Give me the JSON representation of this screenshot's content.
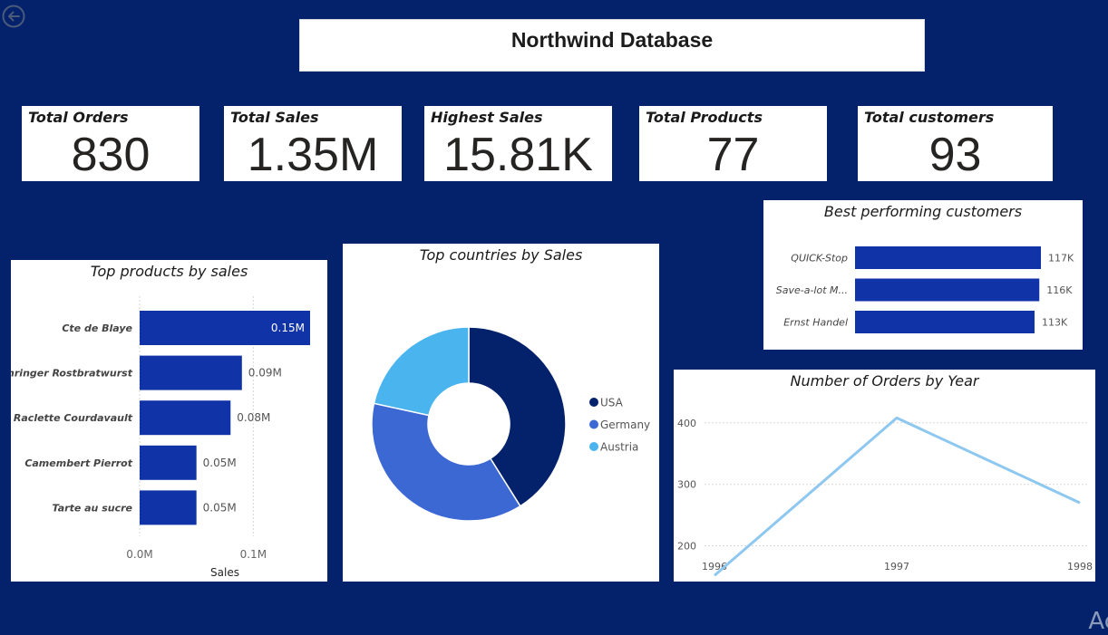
{
  "header": {
    "title": "Northwind Database"
  },
  "kpis": [
    {
      "label": "Total Orders",
      "value": "830"
    },
    {
      "label": "Total Sales",
      "value": "1.35M"
    },
    {
      "label": "Highest Sales",
      "value": "15.81K"
    },
    {
      "label": "Total Products",
      "value": "77"
    },
    {
      "label": "Total customers",
      "value": "93"
    }
  ],
  "colors": {
    "background": "#03226b",
    "bar": "#1033a7",
    "usa": "#03226b",
    "germany": "#3c68d3",
    "austria": "#4ab4ef",
    "line": "#8ec8f0"
  },
  "corner_text": "Ac",
  "chart_data": [
    {
      "type": "bar",
      "title": "Top products by sales",
      "categories": [
        "Cte de Blaye",
        "Thringer Rostbratwurst",
        "Raclette Courdavault",
        "Camembert Pierrot",
        "Tarte au sucre"
      ],
      "values": [
        0.15,
        0.09,
        0.08,
        0.05,
        0.05
      ],
      "data_labels": [
        "0.15M",
        "0.09M",
        "0.08M",
        "0.05M",
        "0.05M"
      ],
      "xlabel": "Sales",
      "xticks": [
        "0.0M",
        "0.1M"
      ],
      "xlim": [
        0,
        0.15
      ],
      "orientation": "horizontal"
    },
    {
      "type": "pie",
      "subtype": "donut",
      "title": "Top countries by Sales",
      "labels": [
        "USA",
        "Germany",
        "Austria"
      ],
      "values": [
        0.411,
        0.373,
        0.216
      ],
      "legend": "right"
    },
    {
      "type": "bar",
      "title": "Best performing customers",
      "categories": [
        "QUICK-Stop",
        "Save-a-lot M...",
        "Ernst Handel"
      ],
      "values": [
        117,
        116,
        113
      ],
      "data_labels": [
        "117K",
        "116K",
        "113K"
      ],
      "orientation": "horizontal"
    },
    {
      "type": "line",
      "title": "Number of Orders by Year",
      "x": [
        "1996",
        "1997",
        "1998"
      ],
      "y": [
        152,
        408,
        270
      ],
      "yticks": [
        "200",
        "300",
        "400"
      ],
      "ylim": [
        145,
        435
      ],
      "grid": true
    }
  ]
}
